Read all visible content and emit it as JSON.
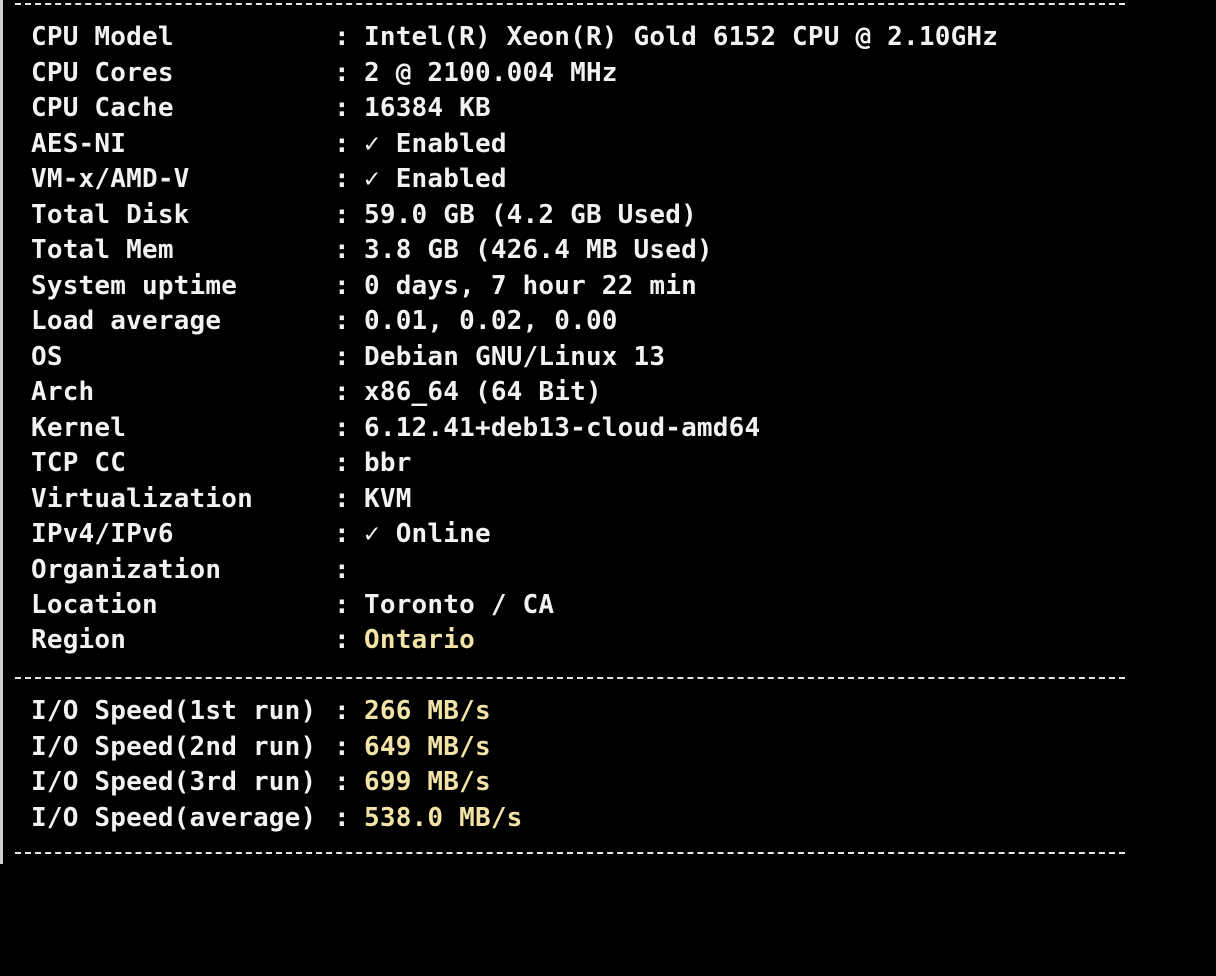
{
  "separator_text": "----------------------------------------------------------------------",
  "system_info": [
    {
      "label": "CPU Model",
      "value": "Intel(R) Xeon(R) Gold 6152 CPU @ 2.10GHz",
      "value_color": "white"
    },
    {
      "label": "CPU Cores",
      "value": "2 @ 2100.004 MHz",
      "value_color": "white"
    },
    {
      "label": "CPU Cache",
      "value": "16384 KB",
      "value_color": "white"
    },
    {
      "label": "AES-NI",
      "value": "✓ Enabled",
      "value_color": "white"
    },
    {
      "label": "VM-x/AMD-V",
      "value": "✓ Enabled",
      "value_color": "white"
    },
    {
      "label": "Total Disk",
      "value": "59.0 GB (4.2 GB Used)",
      "value_color": "white"
    },
    {
      "label": "Total Mem",
      "value": "3.8 GB (426.4 MB Used)",
      "value_color": "white"
    },
    {
      "label": "System uptime",
      "value": "0 days, 7 hour 22 min",
      "value_color": "white"
    },
    {
      "label": "Load average",
      "value": "0.01, 0.02, 0.00",
      "value_color": "white"
    },
    {
      "label": "OS",
      "value": "Debian GNU/Linux 13",
      "value_color": "white"
    },
    {
      "label": "Arch",
      "value": "x86_64 (64 Bit)",
      "value_color": "white"
    },
    {
      "label": "Kernel",
      "value": "6.12.41+deb13-cloud-amd64",
      "value_color": "white"
    },
    {
      "label": "TCP CC",
      "value": "bbr",
      "value_color": "white"
    },
    {
      "label": "Virtualization",
      "value": "KVM",
      "value_color": "white"
    },
    {
      "label": "IPv4/IPv6",
      "value": "✓ Online",
      "value_color": "white"
    },
    {
      "label": "Organization",
      "value": "",
      "value_color": "white"
    },
    {
      "label": "Location",
      "value": "Toronto / CA",
      "value_color": "white"
    },
    {
      "label": "Region",
      "value": "Ontario",
      "value_color": "yellow"
    }
  ],
  "io_speed": [
    {
      "label": "I/O Speed(1st run)",
      "value": "266 MB/s",
      "value_color": "yellow"
    },
    {
      "label": "I/O Speed(2nd run)",
      "value": "649 MB/s",
      "value_color": "yellow"
    },
    {
      "label": "I/O Speed(3rd run)",
      "value": "699 MB/s",
      "value_color": "yellow"
    },
    {
      "label": "I/O Speed(average)",
      "value": "538.0 MB/s",
      "value_color": "yellow"
    }
  ],
  "colors": {
    "background": "#000000",
    "text": "#f2f2f2",
    "highlight": "#f2e3a6"
  }
}
